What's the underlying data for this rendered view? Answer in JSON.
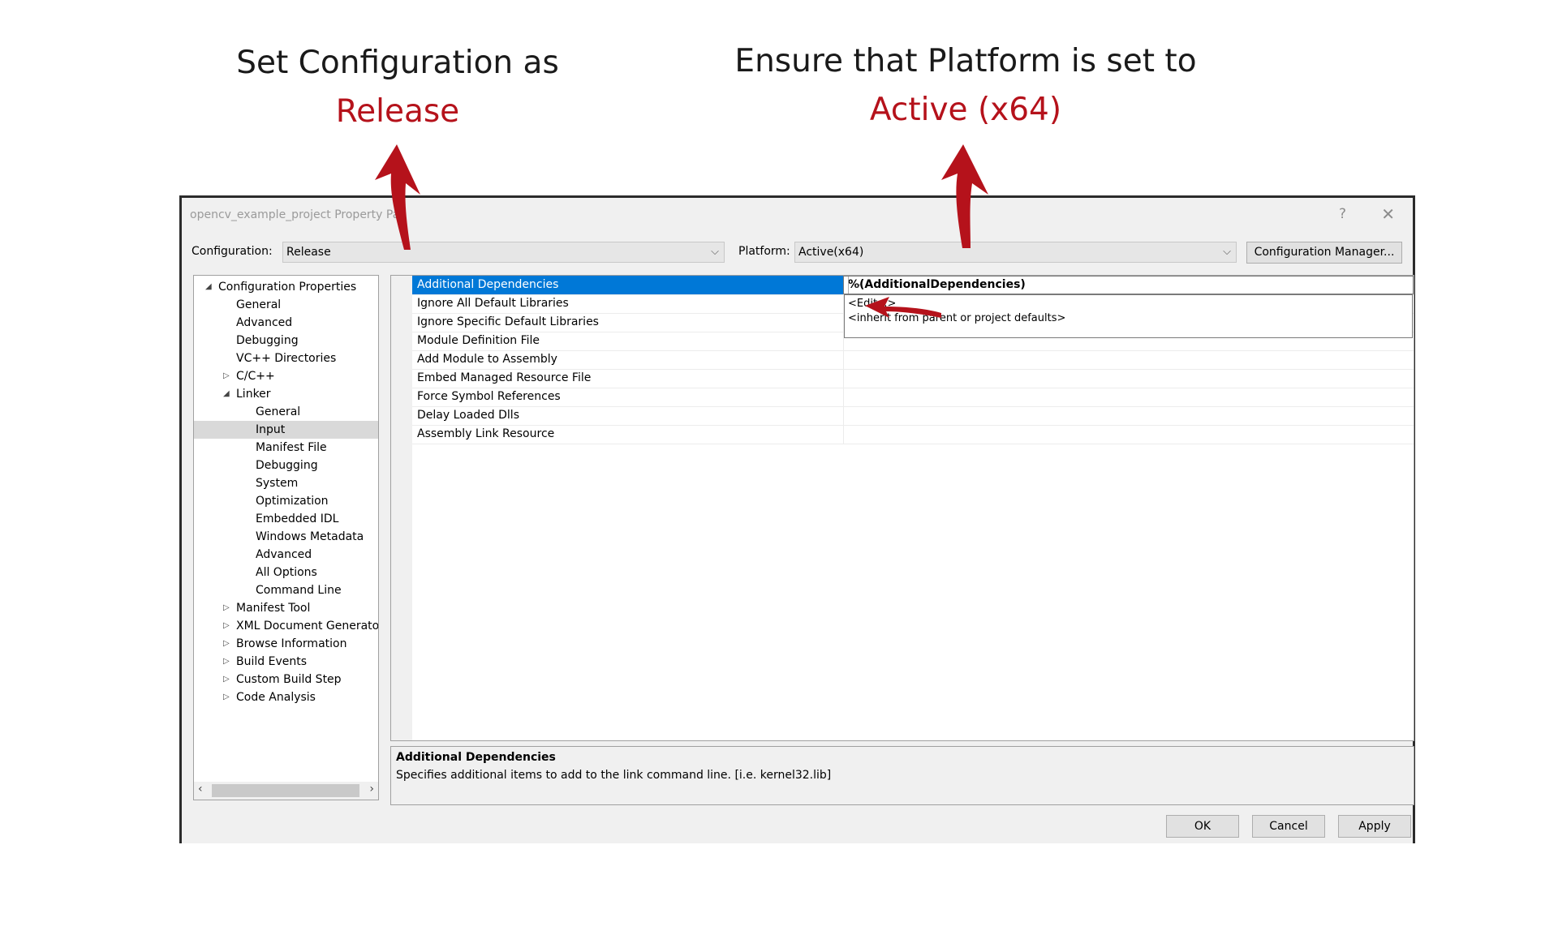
{
  "captions": {
    "left": {
      "line1": "Set Configuration as",
      "line2": "Release"
    },
    "right": {
      "line1": "Ensure that Platform is set to",
      "line2": "Active (x64)"
    },
    "accent_color": "#b5121b"
  },
  "dialog": {
    "title": "opencv_example_project Property Pag",
    "help_glyph": "?",
    "close_glyph": "✕",
    "configuration_label": "Configuration:",
    "configuration_value": "Release",
    "platform_label": "Platform:",
    "platform_value": "Active(x64)",
    "config_manager_label": "Configuration Manager...",
    "tree": [
      {
        "label": "Configuration Properties",
        "level": 0,
        "toggle": "expanded"
      },
      {
        "label": "General",
        "level": 1,
        "toggle": "none"
      },
      {
        "label": "Advanced",
        "level": 1,
        "toggle": "none"
      },
      {
        "label": "Debugging",
        "level": 1,
        "toggle": "none"
      },
      {
        "label": "VC++ Directories",
        "level": 1,
        "toggle": "none"
      },
      {
        "label": "C/C++",
        "level": 1,
        "toggle": "collapsed"
      },
      {
        "label": "Linker",
        "level": 1,
        "toggle": "expanded"
      },
      {
        "label": "General",
        "level": 2,
        "toggle": "none"
      },
      {
        "label": "Input",
        "level": 2,
        "toggle": "none",
        "selected": true
      },
      {
        "label": "Manifest File",
        "level": 2,
        "toggle": "none"
      },
      {
        "label": "Debugging",
        "level": 2,
        "toggle": "none"
      },
      {
        "label": "System",
        "level": 2,
        "toggle": "none"
      },
      {
        "label": "Optimization",
        "level": 2,
        "toggle": "none"
      },
      {
        "label": "Embedded IDL",
        "level": 2,
        "toggle": "none"
      },
      {
        "label": "Windows Metadata",
        "level": 2,
        "toggle": "none"
      },
      {
        "label": "Advanced",
        "level": 2,
        "toggle": "none"
      },
      {
        "label": "All Options",
        "level": 2,
        "toggle": "none"
      },
      {
        "label": "Command Line",
        "level": 2,
        "toggle": "none"
      },
      {
        "label": "Manifest Tool",
        "level": 1,
        "toggle": "collapsed"
      },
      {
        "label": "XML Document Generator",
        "level": 1,
        "toggle": "collapsed"
      },
      {
        "label": "Browse Information",
        "level": 1,
        "toggle": "collapsed"
      },
      {
        "label": "Build Events",
        "level": 1,
        "toggle": "collapsed"
      },
      {
        "label": "Custom Build Step",
        "level": 1,
        "toggle": "collapsed"
      },
      {
        "label": "Code Analysis",
        "level": 1,
        "toggle": "collapsed"
      }
    ],
    "properties": [
      {
        "name": "Additional Dependencies",
        "value": "%(AdditionalDependencies)",
        "selected": true
      },
      {
        "name": "Ignore All Default Libraries",
        "value": ""
      },
      {
        "name": "Ignore Specific Default Libraries",
        "value": ""
      },
      {
        "name": "Module Definition File",
        "value": ""
      },
      {
        "name": "Add Module to Assembly",
        "value": ""
      },
      {
        "name": "Embed Managed Resource File",
        "value": ""
      },
      {
        "name": "Force Symbol References",
        "value": ""
      },
      {
        "name": "Delay Loaded Dlls",
        "value": ""
      },
      {
        "name": "Assembly Link Resource",
        "value": ""
      }
    ],
    "dropdown_options": [
      "<Edit...>",
      "<inherit from parent or project defaults>"
    ],
    "description": {
      "title": "Additional Dependencies",
      "text": "Specifies additional items to add to the link command line. [i.e. kernel32.lib]"
    },
    "buttons": {
      "ok": "OK",
      "cancel": "Cancel",
      "apply": "Apply"
    }
  }
}
